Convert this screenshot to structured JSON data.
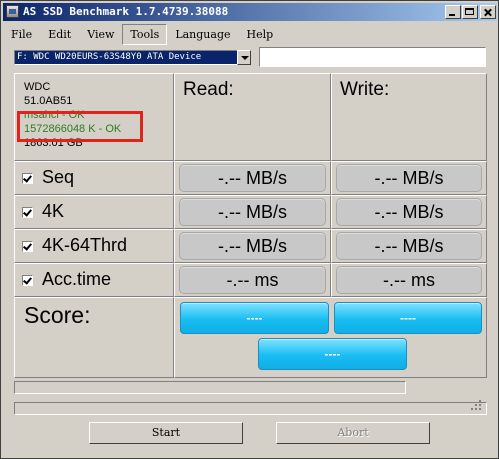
{
  "window": {
    "title": "AS SSD Benchmark 1.7.4739.38088"
  },
  "menu": [
    "File",
    "Edit",
    "View",
    "Tools",
    "Language",
    "Help"
  ],
  "active_menu": "Tools",
  "drive": {
    "selected": "F: WDC WD20EURS-63S48Y0 ATA Device",
    "path_value": ""
  },
  "info": {
    "vendor": "WDC",
    "firmware": "51.0AB51",
    "driver_status": "msahci - OK",
    "alignment_status": "1572866048 K - OK",
    "capacity": "1863.01 GB"
  },
  "columns": {
    "read": "Read:",
    "write": "Write:"
  },
  "tests": [
    {
      "label": "Seq",
      "checked": true,
      "read": "-.-- MB/s",
      "write": "-.-- MB/s"
    },
    {
      "label": "4K",
      "checked": true,
      "read": "-.-- MB/s",
      "write": "-.-- MB/s"
    },
    {
      "label": "4K-64Thrd",
      "checked": true,
      "read": "-.-- MB/s",
      "write": "-.-- MB/s"
    },
    {
      "label": "Acc.time",
      "checked": true,
      "read": "-.-- ms",
      "write": "-.-- ms"
    }
  ],
  "score": {
    "label": "Score:",
    "read": "----",
    "write": "----",
    "total": "----"
  },
  "progress": {
    "top_fill": 0,
    "bottom_fill": 0
  },
  "buttons": {
    "start": "Start",
    "abort": "Abort"
  },
  "colors": {
    "title_start": "#0a246a",
    "title_end": "#a6caf0",
    "ok_text": "#2e7d22",
    "score_pill": "#19bdf3",
    "highlight": "#e0241b"
  }
}
